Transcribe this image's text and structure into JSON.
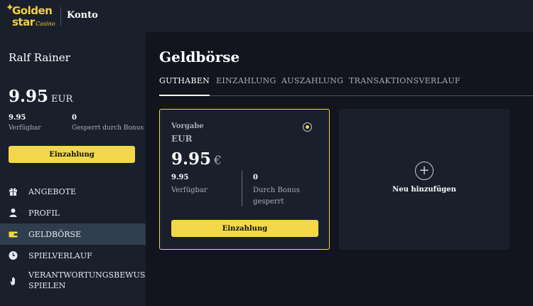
{
  "header": {
    "logo_line1": "Golden",
    "logo_line2": "star",
    "logo_script": "Casino",
    "title": "Konto"
  },
  "sidebar": {
    "user_name": "Ralf Rainer",
    "balance": "9.95",
    "currency": "EUR",
    "available_value": "9.95",
    "available_label": "Verfügbar",
    "locked_value": "0",
    "locked_label": "Gesperrt durch Bonus",
    "deposit_label": "Einzahlung",
    "nav": [
      {
        "label": "ANGEBOTE",
        "icon": "gift-icon"
      },
      {
        "label": "PROFIL",
        "icon": "user-icon"
      },
      {
        "label": "GELDBÖRSE",
        "icon": "wallet-icon"
      },
      {
        "label": "SPIELVERLAUF",
        "icon": "clock-icon"
      },
      {
        "label": "VERANTWORTUNGSBEWUSSTES",
        "label2": "SPIELEN",
        "icon": "hand-icon"
      }
    ]
  },
  "main": {
    "title": "Geldbörse",
    "tabs": [
      {
        "label": "GUTHABEN",
        "active": true
      },
      {
        "label": "EINZAHLUNG"
      },
      {
        "label": "AUSZAHLUNG"
      },
      {
        "label": "TRANSAKTIONSVERLAUF"
      }
    ],
    "wallet": {
      "label": "Vorgabe",
      "currency": "EUR",
      "amount": "9.95",
      "symbol": "€",
      "available_value": "9.95",
      "available_label": "Verfügbar",
      "bonus_value": "0",
      "bonus_label_line1": "Durch Bonus",
      "bonus_label_line2": "gesperrt",
      "deposit_label": "Einzahlung"
    },
    "add_card": {
      "plus": "+",
      "label": "Neu hinzufügen"
    }
  },
  "colors": {
    "accent": "#f2d849",
    "sidebar_bg": "#1a1f2c",
    "main_bg": "#12151e",
    "active_nav_bg": "#2f3d4d"
  }
}
